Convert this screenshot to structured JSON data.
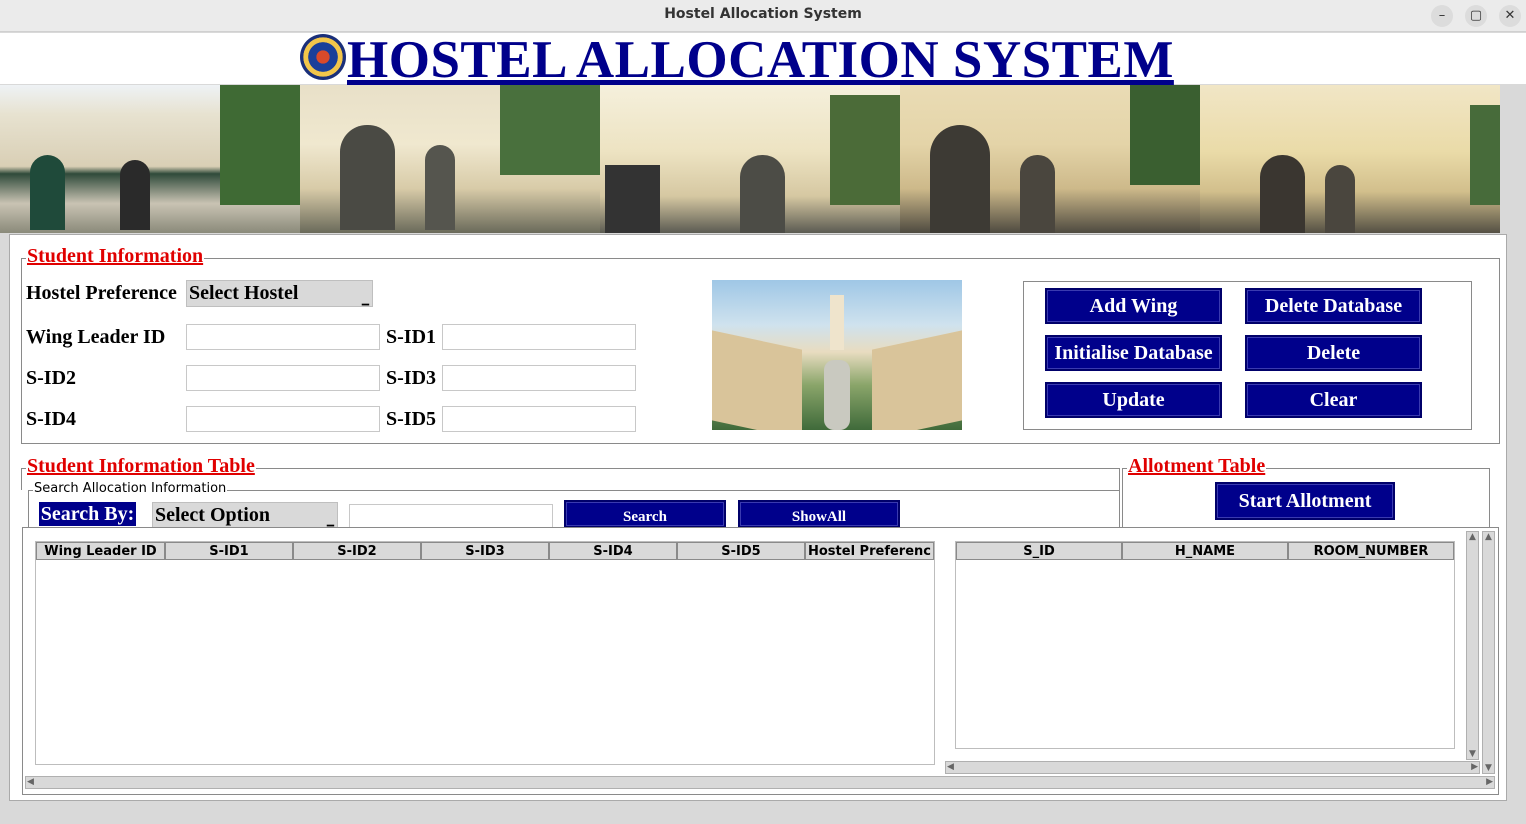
{
  "window": {
    "title": "Hostel Allocation System"
  },
  "header": {
    "title": "HOSTEL ALLOCATION SYSTEM"
  },
  "student_info": {
    "title": "Student Information",
    "hostel_pref_label": "Hostel Preference",
    "hostel_pref_value": "Select Hostel",
    "wing_leader_label": "Wing Leader ID",
    "sid1_label": "S-ID1",
    "sid2_label": "S-ID2",
    "sid3_label": "S-ID3",
    "sid4_label": "S-ID4",
    "sid5_label": "S-ID5"
  },
  "buttons": {
    "add_wing": "Add Wing",
    "delete_database": "Delete Database",
    "initialise_database": "Initialise Database",
    "delete": "Delete",
    "update": "Update",
    "clear": "Clear",
    "start_allotment": "Start Allotment",
    "search": "Search",
    "show_all": "ShowAll"
  },
  "student_table": {
    "title": "Student Information Table",
    "search_group": "Search Allocation Information",
    "search_by_label": "Search By:",
    "search_option": "Select Option",
    "columns": [
      "Wing Leader ID",
      "S-ID1",
      "S-ID2",
      "S-ID3",
      "S-ID4",
      "S-ID5",
      "Hostel Preferenc"
    ]
  },
  "allotment": {
    "title": "Allotment Table",
    "columns": [
      "S_ID",
      "H_NAME",
      "ROOM_NUMBER"
    ]
  },
  "icons": {
    "logo": "institute-logo",
    "dropdown": "dropdown-arrow-icon"
  }
}
